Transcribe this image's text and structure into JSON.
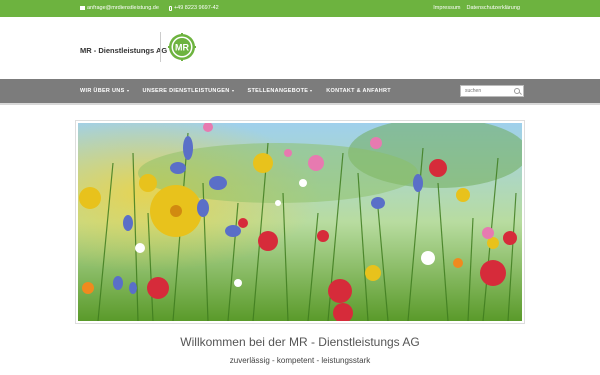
{
  "topbar": {
    "email": "anfrage@mrdienstleistung.de",
    "phone": "+49 8223 9697-42",
    "links": [
      "Impressum",
      "Datenschutzerklärung"
    ]
  },
  "header": {
    "brand": "MR - Dienstleistungs AG",
    "logo_text": "MR"
  },
  "nav": {
    "items": [
      {
        "label": "WIR ÜBER UNS",
        "dropdown": true
      },
      {
        "label": "UNSERE DIENSTLEISTUNGEN",
        "dropdown": true
      },
      {
        "label": "STELLENANGEBOTE",
        "dropdown": true
      },
      {
        "label": "KONTAKT & ANFAHRT",
        "dropdown": false
      }
    ]
  },
  "search": {
    "placeholder": "suchen"
  },
  "main": {
    "welcome": "Willkommen bei der MR - Dienstleistungs AG",
    "tagline": "zuverlässig - kompetent - leistungsstark"
  },
  "colors": {
    "brand_green": "#6db33f",
    "nav_gray": "#7c7c7c"
  }
}
